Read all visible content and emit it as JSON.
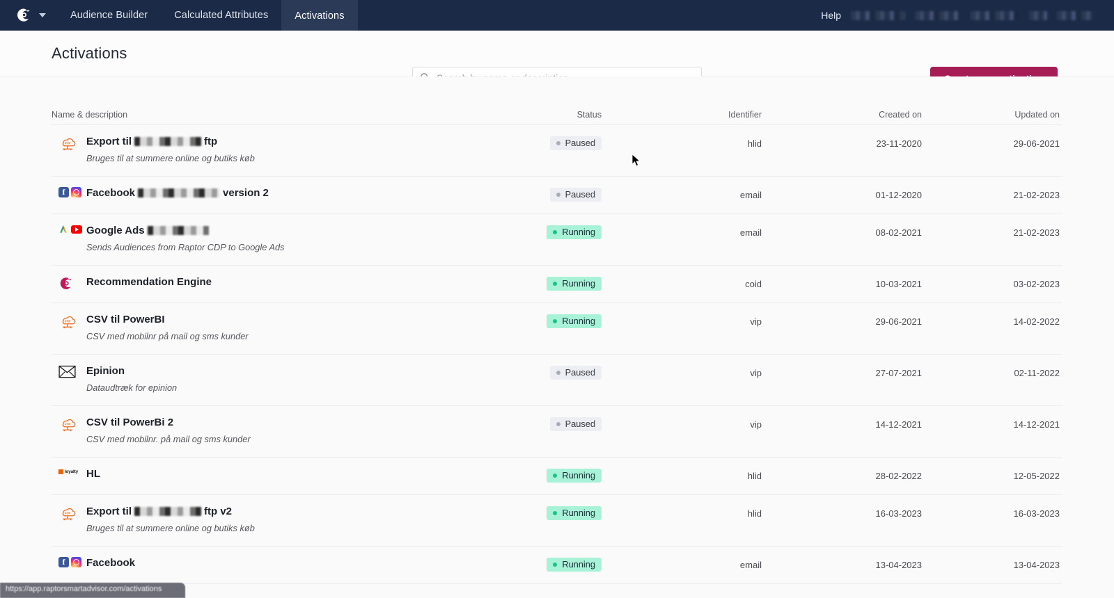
{
  "navbar": {
    "logo_alt": "raptor-logo",
    "links": [
      {
        "label": "Audience Builder",
        "active": false
      },
      {
        "label": "Calculated Attributes",
        "active": false
      },
      {
        "label": "Activations",
        "active": true
      }
    ],
    "help_label": "Help",
    "redacted_user": "██████",
    "redacted_account": "███████"
  },
  "header": {
    "title": "Activations",
    "search_placeholder": "Search by name or description",
    "search_value": "",
    "create_button": "Create new activation",
    "accent_color": "#a61c55"
  },
  "table": {
    "columns": [
      "Name & description",
      "Status",
      "Identifier",
      "Created on",
      "Updated on"
    ],
    "status_colors": {
      "running_bg": "#a8f2d8",
      "running_dot": "#1fc08a",
      "paused_bg": "#edeef3",
      "paused_dot": "#a9abb8"
    },
    "rows": [
      {
        "icon": "ftp-cloud-icon",
        "name_prefix": "Export til",
        "name_redacted": true,
        "name_suffix": "ftp",
        "description": "Bruges til at summere online og butiks køb",
        "status": "Paused",
        "identifier": "hlid",
        "created_on": "23-11-2020",
        "updated_on": "29-06-2021"
      },
      {
        "icon": "facebook-instagram-icon",
        "name_prefix": "Facebook",
        "name_redacted": true,
        "name_suffix": "version 2",
        "description": "",
        "status": "Paused",
        "identifier": "email",
        "created_on": "01-12-2020",
        "updated_on": "21-02-2023"
      },
      {
        "icon": "google-ads-youtube-icon",
        "name_prefix": "Google Ads",
        "name_redacted": true,
        "name_suffix": "",
        "description": "Sends Audiences from Raptor CDP to Google Ads",
        "status": "Running",
        "identifier": "email",
        "created_on": "08-02-2021",
        "updated_on": "21-02-2023"
      },
      {
        "icon": "raptor-icon",
        "name_prefix": "Recommendation Engine",
        "name_redacted": false,
        "name_suffix": "",
        "description": "",
        "status": "Running",
        "identifier": "coid",
        "created_on": "10-03-2021",
        "updated_on": "03-02-2023"
      },
      {
        "icon": "ftp-cloud-icon",
        "name_prefix": "CSV til PowerBI",
        "name_redacted": false,
        "name_suffix": "",
        "description": "CSV med mobilnr på mail og sms kunder",
        "status": "Running",
        "identifier": "vip",
        "created_on": "29-06-2021",
        "updated_on": "14-02-2022"
      },
      {
        "icon": "envelope-icon",
        "name_prefix": "Epinion",
        "name_redacted": false,
        "name_suffix": "",
        "description": "Dataudtræk for epinion",
        "status": "Paused",
        "identifier": "vip",
        "created_on": "27-07-2021",
        "updated_on": "02-11-2022"
      },
      {
        "icon": "ftp-cloud-icon",
        "name_prefix": "CSV til PowerBi 2",
        "name_redacted": false,
        "name_suffix": "",
        "description": "CSV med mobilnr. på mail og sms kunder",
        "status": "Paused",
        "identifier": "vip",
        "created_on": "14-12-2021",
        "updated_on": "14-12-2021"
      },
      {
        "icon": "loyalty-icon",
        "name_prefix": "HL",
        "name_redacted": false,
        "name_suffix": "",
        "description": "",
        "status": "Running",
        "identifier": "hlid",
        "created_on": "28-02-2022",
        "updated_on": "12-05-2022"
      },
      {
        "icon": "ftp-cloud-icon",
        "name_prefix": "Export til",
        "name_redacted": true,
        "name_suffix": "ftp v2",
        "description": "Bruges til at summere online og butiks køb",
        "status": "Running",
        "identifier": "hlid",
        "created_on": "16-03-2023",
        "updated_on": "16-03-2023"
      },
      {
        "icon": "facebook-instagram-icon",
        "name_prefix": "Facebook",
        "name_redacted": false,
        "name_suffix": "",
        "description": "",
        "status": "Running",
        "identifier": "email",
        "created_on": "13-04-2023",
        "updated_on": "13-04-2023"
      }
    ]
  },
  "status_strip": {
    "text": "https://app.raptorsmartadvisor.com/activations"
  }
}
